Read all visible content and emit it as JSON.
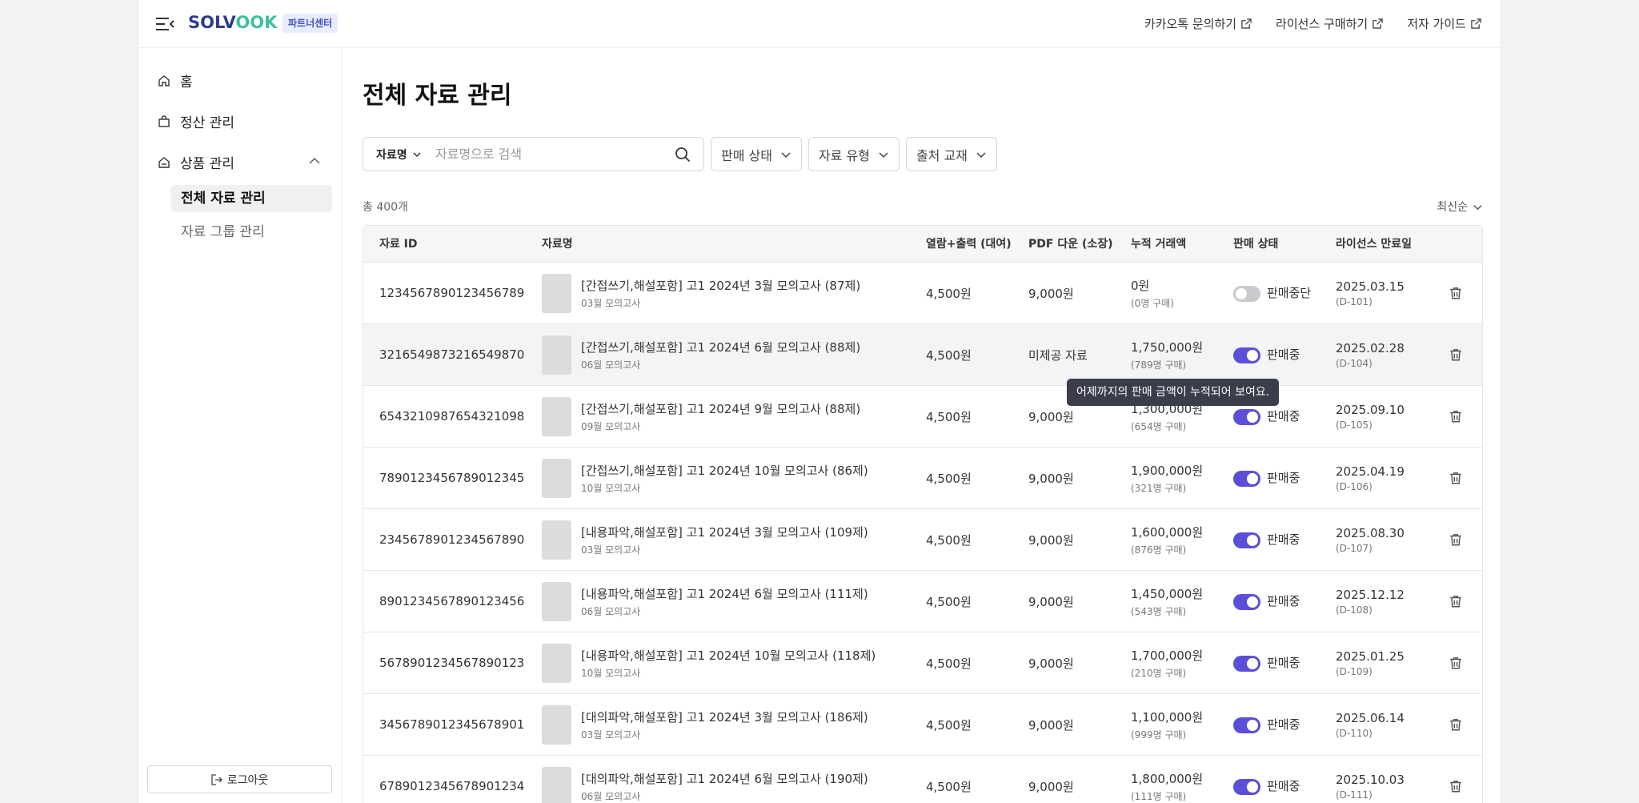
{
  "header": {
    "logo_part1": "SOLV",
    "logo_part2": "OOK",
    "partner_badge": "파트너센터",
    "links": [
      {
        "label": "카카오톡 문의하기"
      },
      {
        "label": "라이선스 구매하기"
      },
      {
        "label": "저자 가이드"
      }
    ]
  },
  "sidebar": {
    "home": "홈",
    "settlement": "정산 관리",
    "products": "상품 관리",
    "sub_all": "전체 자료 관리",
    "sub_group": "자료 그룹 관리",
    "logout": "로그아웃"
  },
  "main": {
    "title": "전체 자료 관리",
    "search_type": "자료명",
    "search_placeholder": "자료명으로 검색",
    "filters": [
      "판매 상태",
      "자료 유형",
      "출처 교재"
    ],
    "total": "총 400개",
    "sort": "최신순",
    "tooltip": "어제까지의 판매 금액이 누적되어 보여요."
  },
  "table": {
    "columns": [
      "자료 ID",
      "자료명",
      "열람+출력 (대여)",
      "PDF 다운 (소장)",
      "누적 거래액",
      "판매 상태",
      "라이선스 만료일"
    ],
    "rows": [
      {
        "id": "1234567890123456789",
        "name": "[간접쓰기,해설포함] 고1 2024년 3월 모의고사 (87제)",
        "sub": "03월 모의고사",
        "view": "4,500원",
        "pdf": "9,000원",
        "total": "0원",
        "buyers": "(0명 구매)",
        "on": false,
        "status": "판매중단",
        "expiry": "2025.03.15",
        "dday": "(D-101)"
      },
      {
        "id": "3216549873216549870",
        "name": "[간접쓰기,해설포함] 고1 2024년 6월 모의고사 (88제)",
        "sub": "06월 모의고사",
        "view": "4,500원",
        "pdf": "미제공 자료",
        "total": "1,750,000원",
        "buyers": "(789명 구매)",
        "on": true,
        "status": "판매중",
        "expiry": "2025.02.28",
        "dday": "(D-104)"
      },
      {
        "id": "6543210987654321098",
        "name": "[간접쓰기,해설포함] 고1 2024년 9월 모의고사 (88제)",
        "sub": "09월 모의고사",
        "view": "4,500원",
        "pdf": "9,000원",
        "total": "1,300,000원",
        "buyers": "(654명 구매)",
        "on": true,
        "status": "판매중",
        "expiry": "2025.09.10",
        "dday": "(D-105)"
      },
      {
        "id": "7890123456789012345",
        "name": "[간접쓰기,해설포함] 고1 2024년 10월 모의고사 (86제)",
        "sub": "10월 모의고사",
        "view": "4,500원",
        "pdf": "9,000원",
        "total": "1,900,000원",
        "buyers": "(321명 구매)",
        "on": true,
        "status": "판매중",
        "expiry": "2025.04.19",
        "dday": "(D-106)"
      },
      {
        "id": "2345678901234567890",
        "name": "[내용파악,해설포함] 고1 2024년 3월 모의고사 (109제)",
        "sub": "03월 모의고사",
        "view": "4,500원",
        "pdf": "9,000원",
        "total": "1,600,000원",
        "buyers": "(876명 구매)",
        "on": true,
        "status": "판매중",
        "expiry": "2025.08.30",
        "dday": "(D-107)"
      },
      {
        "id": "8901234567890123456",
        "name": "[내용파악,해설포함] 고1 2024년 6월 모의고사 (111제)",
        "sub": "06월 모의고사",
        "view": "4,500원",
        "pdf": "9,000원",
        "total": "1,450,000원",
        "buyers": "(543명 구매)",
        "on": true,
        "status": "판매중",
        "expiry": "2025.12.12",
        "dday": "(D-108)"
      },
      {
        "id": "5678901234567890123",
        "name": "[내용파악,해설포함] 고1 2024년 10월 모의고사 (118제)",
        "sub": "10월 모의고사",
        "view": "4,500원",
        "pdf": "9,000원",
        "total": "1,700,000원",
        "buyers": "(210명 구매)",
        "on": true,
        "status": "판매중",
        "expiry": "2025.01.25",
        "dday": "(D-109)"
      },
      {
        "id": "3456789012345678901",
        "name": "[대의파악,해설포함] 고1 2024년 3월 모의고사 (186제)",
        "sub": "03월 모의고사",
        "view": "4,500원",
        "pdf": "9,000원",
        "total": "1,100,000원",
        "buyers": "(999명 구매)",
        "on": true,
        "status": "판매중",
        "expiry": "2025.06.14",
        "dday": "(D-110)"
      },
      {
        "id": "6789012345678901234",
        "name": "[대의파악,해설포함] 고1 2024년 6월 모의고사 (190제)",
        "sub": "06월 모의고사",
        "view": "4,500원",
        "pdf": "9,000원",
        "total": "1,800,000원",
        "buyers": "(111명 구매)",
        "on": true,
        "status": "판매중",
        "expiry": "2025.10.03",
        "dday": "(D-111)"
      }
    ]
  },
  "colors": {
    "accent": "#5a4fd6",
    "toggle_off": "#c9c9ce",
    "brand_blue": "#2f3b8f",
    "brand_green": "#3fc0a0"
  }
}
